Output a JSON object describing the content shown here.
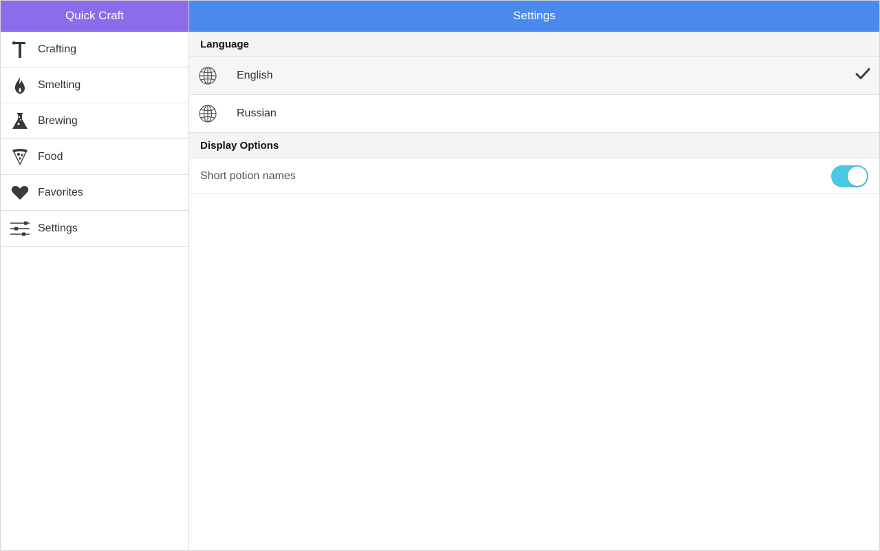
{
  "sidebar": {
    "title": "Quick Craft",
    "accent_color": "#8c6cea",
    "items": [
      {
        "label": "Crafting",
        "icon": "hammer-icon"
      },
      {
        "label": "Smelting",
        "icon": "flame-icon"
      },
      {
        "label": "Brewing",
        "icon": "flask-icon"
      },
      {
        "label": "Food",
        "icon": "pizza-icon"
      },
      {
        "label": "Favorites",
        "icon": "heart-icon"
      },
      {
        "label": "Settings",
        "icon": "sliders-icon"
      }
    ]
  },
  "main": {
    "title": "Settings",
    "accent_color": "#4a8aee",
    "language_section": {
      "header": "Language",
      "options": [
        {
          "label": "English",
          "icon": "globe-icon",
          "selected": true
        },
        {
          "label": "Russian",
          "icon": "globe-icon",
          "selected": false
        }
      ]
    },
    "display_section": {
      "header": "Display Options",
      "short_potion_names": {
        "label": "Short potion names",
        "enabled": true,
        "toggle_color": "#4ac7e3"
      }
    }
  }
}
